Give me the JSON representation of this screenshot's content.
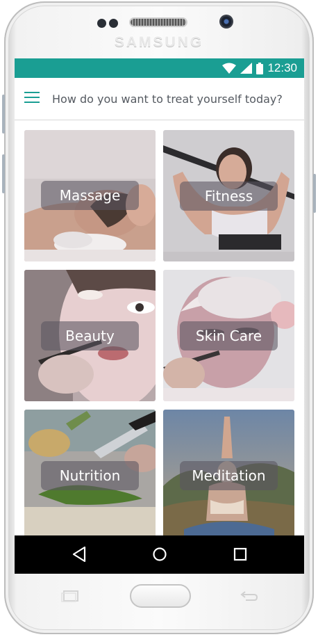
{
  "device": {
    "brand": "SAMSUNG"
  },
  "status_bar": {
    "time": "12:30",
    "color": "#1a9e93"
  },
  "header": {
    "title": "How do you want to treat yourself today?",
    "menu_icon": "hamburger-menu-icon"
  },
  "categories": [
    {
      "label": "Massage"
    },
    {
      "label": "Fitness"
    },
    {
      "label": "Beauty"
    },
    {
      "label": "Skin Care"
    },
    {
      "label": "Nutrition"
    },
    {
      "label": "Meditation"
    }
  ],
  "nav_bar": {
    "back_icon": "back-triangle-icon",
    "home_icon": "home-circle-icon",
    "recents_icon": "recents-square-icon"
  }
}
